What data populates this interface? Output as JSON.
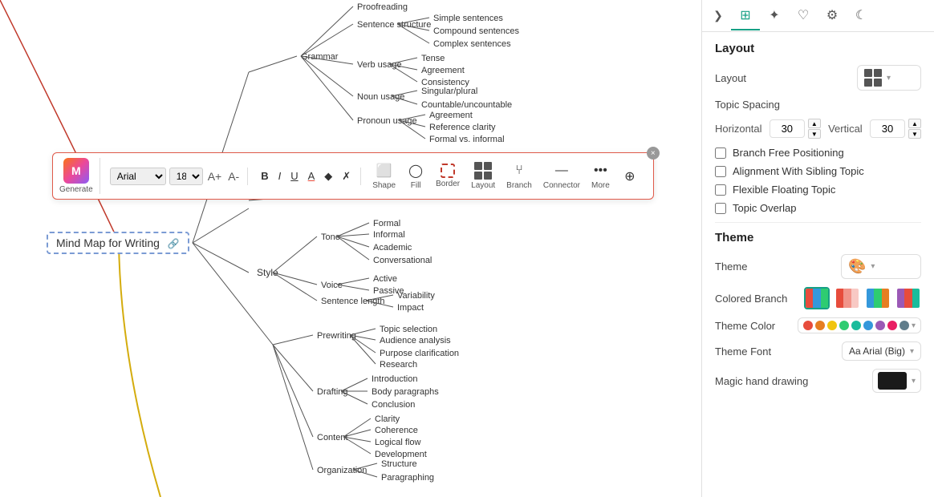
{
  "toolbar": {
    "close_icon": "×",
    "font_name": "Arial",
    "font_size": "18",
    "increase_size_label": "A+",
    "decrease_size_label": "A-",
    "bold_label": "B",
    "italic_label": "I",
    "underline_label": "U",
    "color_label": "A",
    "highlight_label": "◆",
    "eraser_label": "✗",
    "generate_label": "Generate",
    "shape_label": "Shape",
    "fill_label": "Fill",
    "border_label": "Border",
    "layout_label": "Layout",
    "branch_label": "Branch",
    "connector_label": "Connector",
    "more_label": "More",
    "pin_label": "⊕"
  },
  "node": {
    "label": "Mind Map for Writing",
    "link_icon": "🔗"
  },
  "panel": {
    "collapse_icon": "❯",
    "tab_layout_icon": "⊞",
    "tab_ai_icon": "✦",
    "tab_heart_icon": "♡",
    "tab_settings_icon": "⚙",
    "tab_moon_icon": "☾",
    "layout_section": "Layout",
    "layout_label": "Layout",
    "topic_spacing_label": "Topic Spacing",
    "horizontal_label": "Horizontal",
    "vertical_label": "Vertical",
    "horizontal_value": "30",
    "vertical_value": "30",
    "branch_free_positioning_label": "Branch Free Positioning",
    "alignment_sibling_topic_label": "Alignment With Sibling Topic",
    "flexible_floating_topic_label": "Flexible Floating Topic",
    "topic_overlap_label": "Topic Overlap",
    "theme_section": "Theme",
    "theme_label": "Theme",
    "colored_branch_label": "Colored Branch",
    "theme_color_label": "Theme Color",
    "theme_font_label": "Theme Font",
    "theme_font_value": "Aa Arial (Big)",
    "magic_hand_drawing_label": "Magic hand drawing",
    "branch_free_checked": false,
    "alignment_sibling_checked": false,
    "flexible_floating_checked": false,
    "topic_overlap_checked": false,
    "theme_colors": [
      "#e74c3c",
      "#e67e22",
      "#f1c40f",
      "#2ecc71",
      "#1abc9c",
      "#3498db",
      "#9b59b6",
      "#e91e63",
      "#607d8b"
    ]
  }
}
